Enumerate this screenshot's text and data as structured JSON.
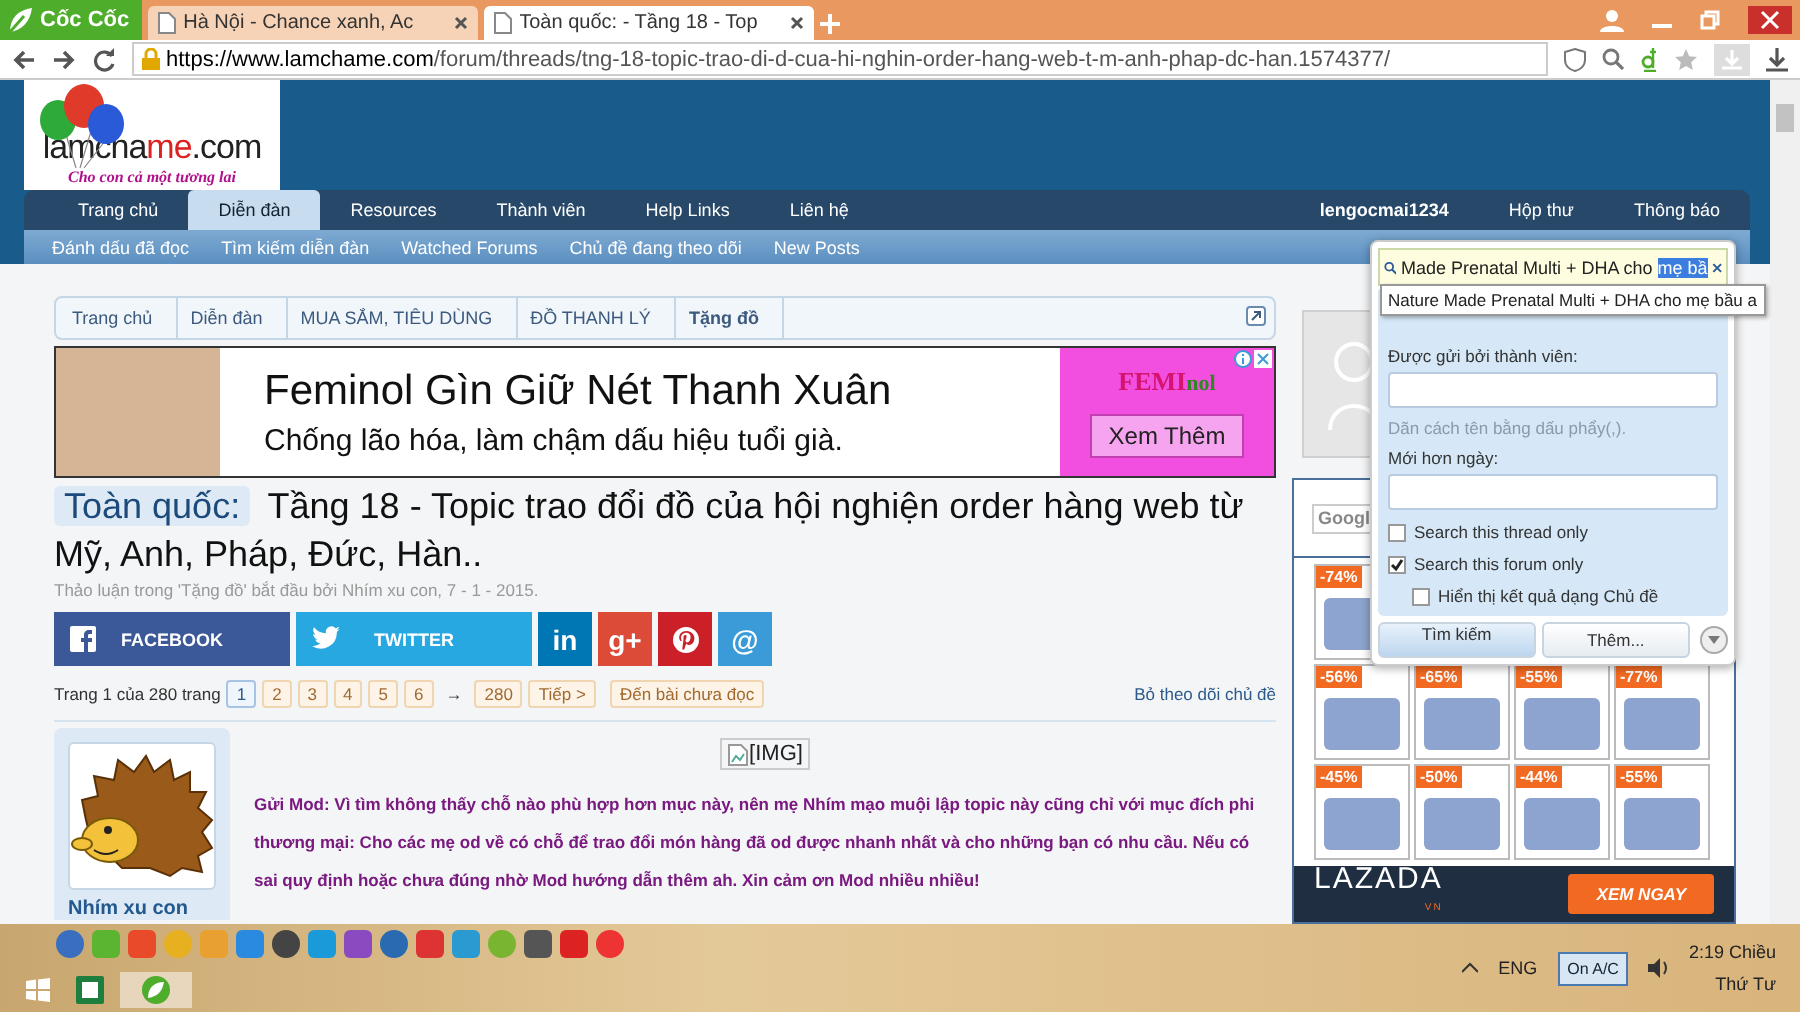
{
  "browser": {
    "brand": "Cốc Cốc",
    "tabs": [
      {
        "label": "Hà Nội - Chance xanh, Ac",
        "selected": false
      },
      {
        "label": "Toàn quốc: - Tầng 18 - Top",
        "selected": true
      }
    ],
    "url_host": "https://www.lamchame.com",
    "url_path": "/forum/threads/tng-18-topic-trao-di-d-cua-hi-nghin-order-hang-web-t-m-anh-phap-dc-han.1574377/"
  },
  "site": {
    "logo_a": "lamcha",
    "logo_b": "me",
    "logo_c": ".com",
    "tagline": "Cho con cả một tương lai"
  },
  "nav": {
    "tabs": [
      {
        "label": "Trang chủ",
        "selected": false
      },
      {
        "label": "Diễn đàn",
        "selected": true
      },
      {
        "label": "Resources",
        "selected": false
      },
      {
        "label": "Thành viên",
        "selected": false
      },
      {
        "label": "Help Links",
        "selected": false
      },
      {
        "label": "Liên hệ",
        "selected": false
      }
    ],
    "user_links": [
      "lengocmai1234",
      "Hộp thư",
      "Thông báo"
    ],
    "sub_links": [
      "Đánh dấu đã đọc",
      "Tìm kiếm diễn đàn",
      "Watched Forums",
      "Chủ đề đang theo dõi",
      "New Posts"
    ]
  },
  "breadcrumbs": [
    "Trang chủ",
    "Diễn đàn",
    "MUA SẮM, TIÊU DÙNG",
    "ĐỒ THANH LÝ",
    "Tặng đồ"
  ],
  "ad": {
    "headline": "Feminol Gìn Giữ Nét Thanh Xuân",
    "subline": "Chống lão hóa, làm chậm dấu hiệu tuổi già.",
    "brand_a": "FEMI",
    "brand_b": "nol",
    "button": "Xem Thêm"
  },
  "thread": {
    "prefix": "Toàn quốc:",
    "title": "Tầng 18 - Topic trao đổi đồ của hội nghiện order hàng web từ Mỹ, Anh, Pháp, Đức, Hàn..",
    "meta": "Thảo luận trong 'Tặng đồ' bắt đầu bởi Nhím xu con, 7 - 1 - 2015."
  },
  "share": [
    {
      "kind": "facebook",
      "label": "FACEBOOK"
    },
    {
      "kind": "twitter",
      "label": "TWITTER"
    },
    {
      "kind": "linkedin",
      "label": "in"
    },
    {
      "kind": "googleplus",
      "label": "g+"
    },
    {
      "kind": "pinterest"
    },
    {
      "kind": "email",
      "label": "@"
    }
  ],
  "pagination": {
    "summary": "Trang 1 của 280 trang",
    "pages": [
      {
        "label": "1",
        "selected": true
      },
      {
        "label": "2",
        "selected": false
      },
      {
        "label": "3",
        "selected": false
      },
      {
        "label": "4",
        "selected": false
      },
      {
        "label": "5",
        "selected": false
      },
      {
        "label": "6",
        "selected": false
      }
    ],
    "arrow": "→",
    "last": "280",
    "next": "Tiếp >",
    "unread": "Đến bài chưa đọc",
    "unwatch": "Bỏ theo dõi chủ đề"
  },
  "post": {
    "author": "Nhím xu con",
    "image_alt": "[IMG]",
    "body": "Gửi Mod: Vì tìm không thấy chỗ nào phù hợp hơn mục này, nên mẹ Nhím mạo muội lập topic này cũng chỉ với mục đích phi thương mại: Cho các mẹ od về có chỗ để trao đổi món hàng đã od được nhanh nhất và cho những bạn có nhu cầu. Nếu có sai quy định hoặc chưa đúng nhờ Mod hướng dẫn thêm ah. Xin cảm ơn Mod nhiều nhiều!"
  },
  "sidebar": {
    "google_placeholder": "Googl",
    "deals": [
      "-74%",
      "-56%",
      "-65%",
      "-55%",
      "-77%",
      "-45%",
      "-50%",
      "-44%",
      "-55%"
    ],
    "lazada": "LAZADA",
    "lazada_sub": "VN",
    "cta": "XEM NGAY"
  },
  "search_popup": {
    "query": "Made Prenatal Multi + DHA cho ",
    "query_selected": "mẹ bầ",
    "suggestion": "Nature Made Prenatal Multi + DHA cho mẹ bầu a",
    "member_label": "Được gửi bởi thành viên:",
    "member_hint": "Dãn cách tên bằng dấu phẩy(,).",
    "date_label": "Mới hơn ngày:",
    "options": [
      {
        "label": "Search this thread only",
        "checked": false
      },
      {
        "label": "Search this forum only",
        "checked": true,
        "children": [
          {
            "label": "Hiển thị kết quả dạng Chủ đề",
            "checked": false
          }
        ]
      }
    ],
    "buttons": [
      "Tìm kiếm",
      "Thêm..."
    ]
  },
  "taskbar": {
    "lang": "ENG",
    "power": "On A/C",
    "time": "2:19 Chiều",
    "day": "Thứ Tư"
  }
}
